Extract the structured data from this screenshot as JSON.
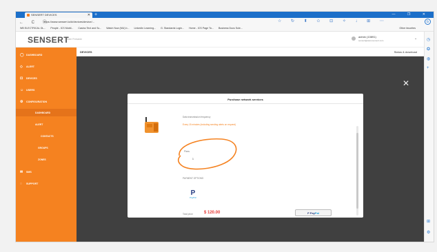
{
  "browser": {
    "tab_title": "SENSERT DEVICES",
    "new_tab": "+",
    "window_controls": "— ❐ ✕",
    "nav_glyphs": "← C ⓘ",
    "url": "https://www.sensert.io/#/devices/device/...",
    "address_icons": "☆ ↻ ⬍ ✩ ⊡ ✧ ↓ ⊞ ⋯",
    "profile_initial": "b",
    "favorites": [
      "WB ELECTRICAL DL...",
      "People - ICS Mobil...",
      "Casino Text and Sc...",
      "Watch Now (MU) b...",
      "LinkedIn Learning...",
      "G. Standards Login...",
      "Home - ICS Page To...",
      "Business Docs Sole..."
    ],
    "other_favorites": "Other favorites",
    "edge_icons": [
      "◷",
      "✪",
      "◍",
      "+",
      "⊞",
      "⚙"
    ]
  },
  "header": {
    "logo": "SENSERT",
    "subtitle": "Safe Printable",
    "user_name": "admin (10891)",
    "user_email": "sensert@www.sensert.com",
    "caret": "⌄"
  },
  "sidebar": {
    "items": [
      {
        "label": "DASHBOARD",
        "icon": "◯"
      },
      {
        "label": "ALERT",
        "icon": "◇"
      },
      {
        "label": "DEVICES",
        "icon": "⊡"
      },
      {
        "label": "USERS",
        "icon": "☺"
      },
      {
        "label": "CONFIGURATION",
        "icon": "⚙"
      },
      {
        "label": "DASHBOARD",
        "icon": ""
      },
      {
        "label": "ALERT",
        "icon": ""
      },
      {
        "label": "CONTACTS",
        "icon": ""
      },
      {
        "label": "GROUPS",
        "icon": ""
      },
      {
        "label": "ZONES",
        "icon": ""
      },
      {
        "label": "SMS",
        "icon": "✉"
      },
      {
        "label": "SUPPORT",
        "icon": "◌"
      }
    ]
  },
  "main": {
    "title": "DEVICES",
    "right_action": "Status & download",
    "close_glyph": "✕"
  },
  "modal": {
    "title": "Purchase network services",
    "data_label": "Data transmission frequency",
    "data_value": "Every 15 minutes (including sending alerts on request)",
    "plan_label": "Plans",
    "plan_value": "1",
    "payment_label": "PAYMENT OPTIONS",
    "paypal_letter": "P",
    "paypal_caption": "PayPal",
    "total_label": "Total price:",
    "total_value": "$ 120.00",
    "pay_button_p": "P",
    "pay_button_pay": "Pay",
    "pay_button_pal": "Pal"
  },
  "colors": {
    "brand_orange": "#f58220",
    "edge_blue": "#1c6fc9",
    "total_red": "#e53935"
  }
}
